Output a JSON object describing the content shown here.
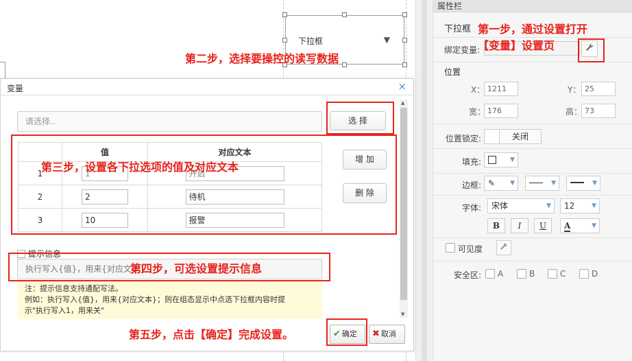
{
  "canvas": {
    "widget_label": "下拉框",
    "widget_arrow": "▼"
  },
  "dialog": {
    "title": "变量",
    "close_icon": "close-icon",
    "select_placeholder": "请选择..",
    "select_button": "选 择",
    "add_button": "增 加",
    "delete_button": "删 除",
    "table": {
      "headers": [
        "",
        "值",
        "对应文本"
      ],
      "rows": [
        {
          "index": "1",
          "value": "1",
          "text": "开启"
        },
        {
          "index": "2",
          "value": "2",
          "text": "待机"
        },
        {
          "index": "3",
          "value": "10",
          "text": "报警"
        }
      ]
    },
    "tip_label": "提示信息",
    "tip_placeholder": "执行写入{值}，用来{对应文本}",
    "note_lines": [
      "注：提示信息支持通配写法。",
      "例如：执行写入{值}，用来{对应文本}；则在组态显示中点选下拉框内容时提",
      "示\"执行写入1，用来关\""
    ],
    "ok_label": "确定",
    "cancel_label": "取消"
  },
  "props": {
    "header": "属性栏",
    "widget_type": "下拉框",
    "bind_var_label": "绑定变量:",
    "wrench_icon": "wrench-icon",
    "position_title": "位置",
    "x_label": "X：",
    "x_value": "1211",
    "y_label": "Y：",
    "y_value": "25",
    "w_label": "宽：",
    "w_value": "176",
    "h_label": "高：",
    "h_value": "73",
    "lock_label": "位置锁定:",
    "lock_value": "关闭",
    "fill_label": "填充:",
    "border_label": "边框:",
    "font_label": "字体:",
    "font_family": "宋体",
    "font_size": "12",
    "bold": "B",
    "italic": "I",
    "underline": "U",
    "font_color_letter": "A",
    "visible_label": "可见度",
    "safezone_label": "安全区:",
    "safezones": [
      "A",
      "B",
      "C",
      "D"
    ]
  },
  "annotations": {
    "step1_line1": "第一步，通过设置打开",
    "step1_line2": "【变量】设置页",
    "step2": "第二步，选择要操控的读写数据",
    "step3": "第三步，设置各下拉选项的值及对应文本",
    "step4": "第四步，可选设置提示信息",
    "step5": "第五步，点击【确定】完成设置。"
  },
  "colors": {
    "annotation": "#e8221a",
    "accent_blue": "#5a8fd0",
    "note_bg": "#fffbd9"
  }
}
